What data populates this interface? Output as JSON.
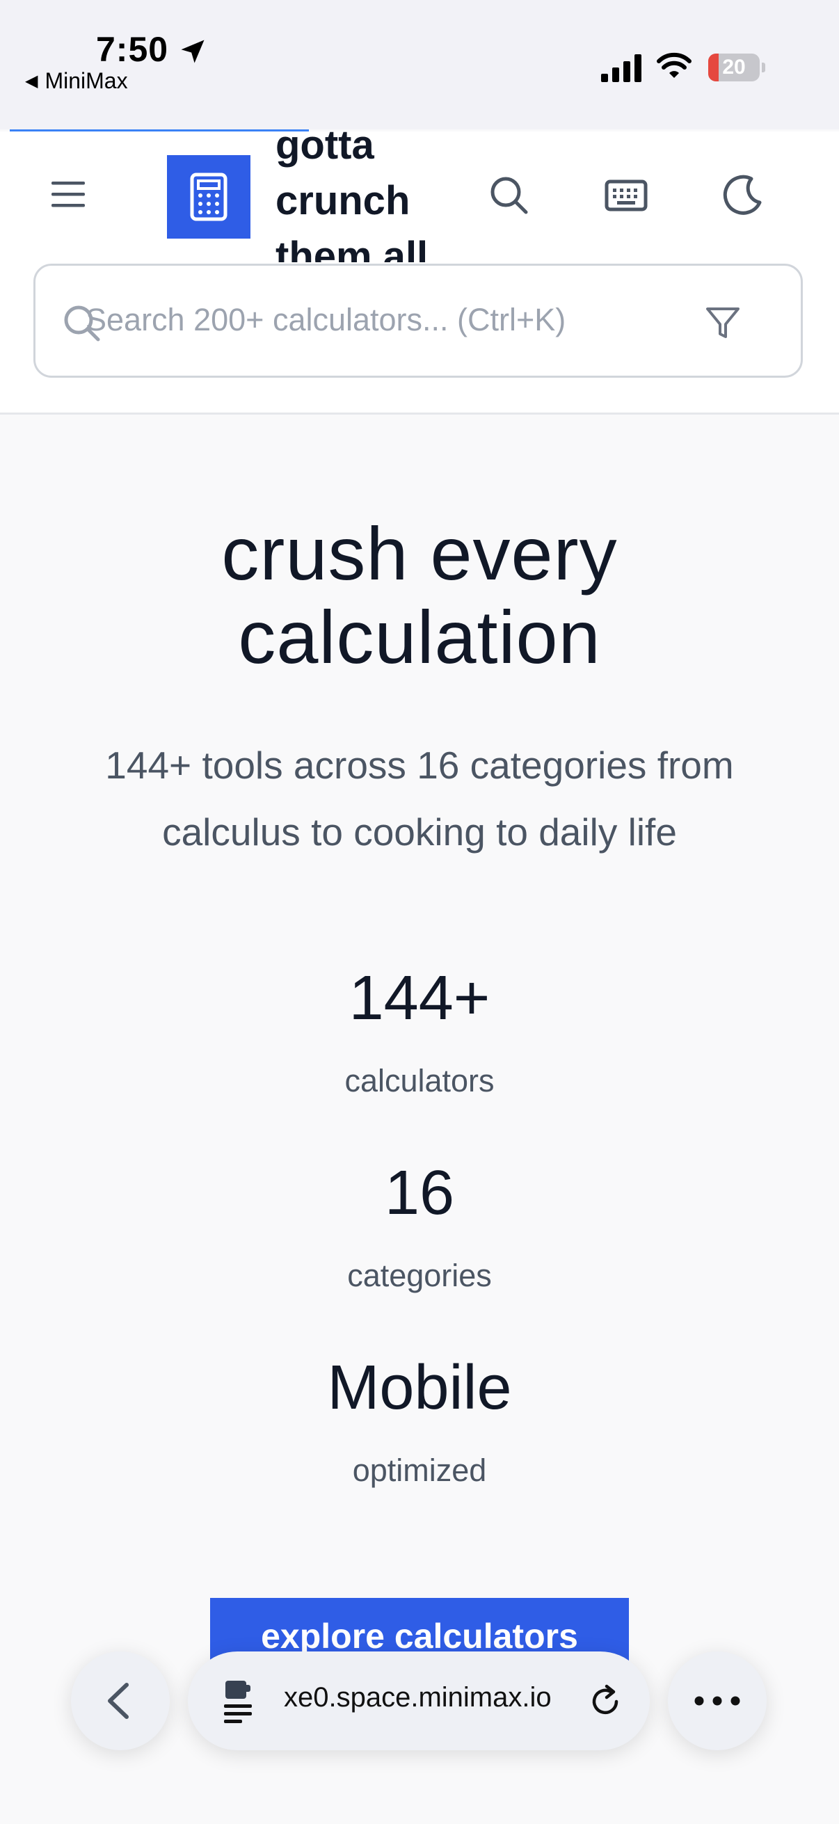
{
  "status_bar": {
    "time": "7:50",
    "back_app": "MiniMax",
    "battery": "20",
    "battery_level": 0.2
  },
  "header": {
    "brand_lines": [
      "gotta",
      "crunch",
      "them all"
    ],
    "search_placeholder": "Search 200+ calculators... (Ctrl+K)",
    "icons": [
      "menu-icon",
      "calculator-icon",
      "search-icon",
      "keyboard-icon",
      "moon-icon",
      "filter-icon"
    ],
    "accent_color": "#2f5de6"
  },
  "hero": {
    "title_line1": "crush every",
    "title_line2": "calculation",
    "subtitle_line1": "144+ tools across 16 categories from",
    "subtitle_line2": "calculus to cooking to daily life"
  },
  "stats": [
    {
      "value": "144+",
      "label": "calculators"
    },
    {
      "value": "16",
      "label": "categories"
    },
    {
      "value": "Mobile",
      "label": "optimized"
    }
  ],
  "cta": {
    "label": "explore calculators"
  },
  "browser_bar": {
    "url": "xe0.space.minimax.io",
    "icons": [
      "back-chevron-icon",
      "page-settings-icon",
      "reload-icon",
      "more-icon"
    ]
  }
}
